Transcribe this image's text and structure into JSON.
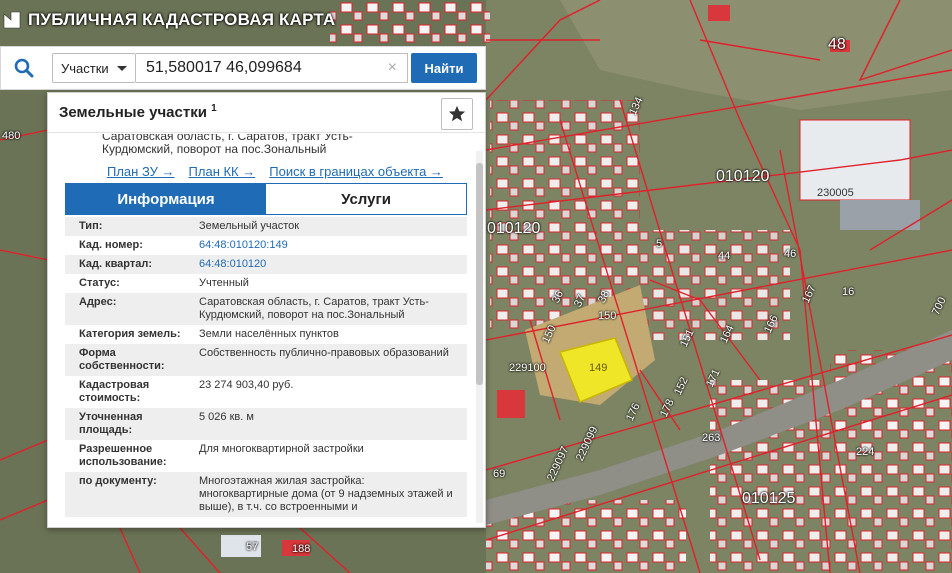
{
  "app": {
    "title": "ПУБЛИЧНАЯ КАДАСТРОВАЯ КАРТА"
  },
  "search": {
    "type_label": "Участки",
    "query": "51,580017 46,099684",
    "clear_glyph": "×",
    "find_label": "Найти"
  },
  "panel": {
    "title": "Земельные участки",
    "title_sup": "1",
    "address_preview": "Саратовская область, г. Саратов, тракт Усть-Курдюмский, поворот на пос.Зональный",
    "links": [
      "План ЗУ →",
      "План КК →",
      "Поиск в границах объекта →"
    ],
    "tabs": {
      "info": "Информация",
      "services": "Услуги"
    },
    "rows": [
      {
        "key": "Тип:",
        "value": "Земельный участок"
      },
      {
        "key": "Кад. номер:",
        "value": "64:48:010120:149"
      },
      {
        "key": "Кад. квартал:",
        "value": "64:48:010120"
      },
      {
        "key": "Статус:",
        "value": "Учтенный"
      },
      {
        "key": "Адрес:",
        "value": "Саратовская область, г. Саратов, тракт Усть-Курдюмский, поворот на пос.Зональный"
      },
      {
        "key": "Категория земель:",
        "value": "Земли населённых пунктов"
      },
      {
        "key": "Форма собственности:",
        "value": "Собственность публично-правовых образований"
      },
      {
        "key": "Кадастровая стоимость:",
        "value": "23 274 903,40 руб."
      },
      {
        "key": "Уточненная площадь:",
        "value": "5 026 кв. м"
      },
      {
        "key": "Разрешенное использование:",
        "value": "Для многоквартирной застройки"
      },
      {
        "key": "по документу:",
        "value": "Многоэтажная жилая застройка: многоквартирные дома (от 9 надземных этажей и выше), в т.ч. со встроенными и"
      }
    ]
  },
  "map": {
    "labels": {
      "block_48": "48",
      "block_010120_a": "010120",
      "block_010120_b": "010120",
      "block_010125": "010125",
      "block_230005": "230005",
      "block_229100": "229100",
      "block_229099": "229099",
      "block_229097": "229097",
      "p480": "480",
      "p149": "149",
      "p150a": "150",
      "p150b": "150",
      "p151": "151",
      "p152": "152",
      "p176": "176",
      "p178": "178",
      "p171": "171",
      "p164": "164",
      "p166": "166",
      "p167": "167",
      "p16": "16",
      "p46": "46",
      "p44": "44",
      "p263": "263",
      "p224": "224",
      "p69": "69",
      "p57": "57",
      "p188": "188",
      "p700": "700",
      "p134": "134",
      "p5": "5",
      "p36": "36",
      "p37": "37",
      "p38": "38"
    },
    "colors": {
      "boundary": "#e0202a",
      "selected_fill": "#f0e628"
    }
  }
}
